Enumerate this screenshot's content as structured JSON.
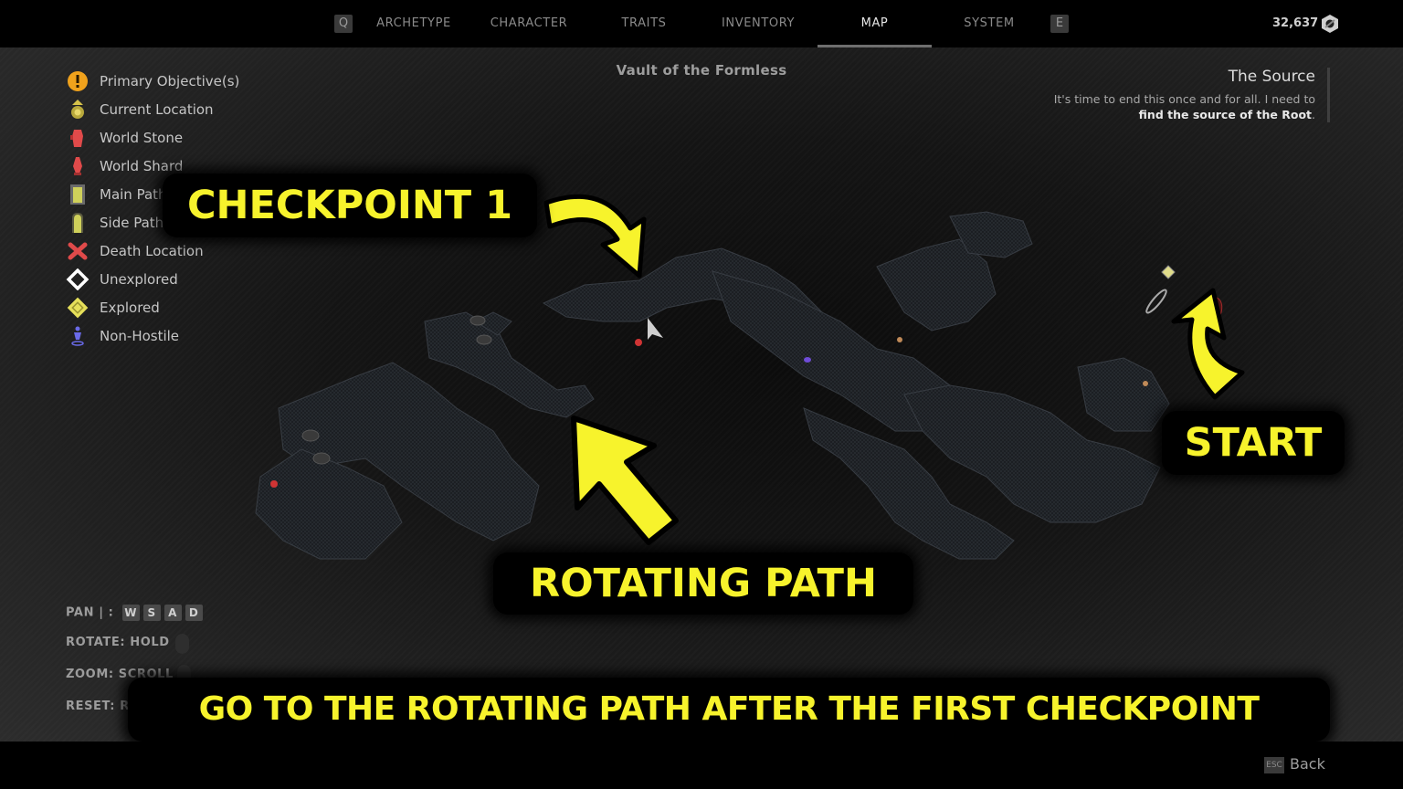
{
  "nav": {
    "prev_key": "Q",
    "next_key": "E",
    "tabs": [
      {
        "label": "ARCHETYPE",
        "active": false
      },
      {
        "label": "CHARACTER",
        "active": false
      },
      {
        "label": "TRAITS",
        "active": false
      },
      {
        "label": "INVENTORY",
        "active": false
      },
      {
        "label": "MAP",
        "active": true
      },
      {
        "label": "SYSTEM",
        "active": false
      }
    ],
    "currency": "32,637",
    "currency_icon": "scrap-hex-nut-icon"
  },
  "map": {
    "zone_title": "Vault of the Formless",
    "legend": [
      {
        "label": "Primary Objective(s)",
        "icon": "primary-objective-icon",
        "color": "#f0a21c"
      },
      {
        "label": "Current Location",
        "icon": "current-location-icon",
        "color": "#d6c24a"
      },
      {
        "label": "World Stone",
        "icon": "world-stone-icon",
        "color": "#e04a4a"
      },
      {
        "label": "World Shard",
        "icon": "world-shard-icon",
        "color": "#e04a4a"
      },
      {
        "label": "Main Path",
        "icon": "main-path-icon",
        "color": "#cfd05a"
      },
      {
        "label": "Side Path",
        "icon": "side-path-icon",
        "color": "#cfd05a"
      },
      {
        "label": "Death Location",
        "icon": "death-location-icon",
        "color": "#e04a4a"
      },
      {
        "label": "Unexplored",
        "icon": "unexplored-icon",
        "color": "#ffffff"
      },
      {
        "label": "Explored",
        "icon": "explored-icon",
        "color": "#e6e05a"
      },
      {
        "label": "Non-Hostile",
        "icon": "non-hostile-icon",
        "color": "#6a6ae8"
      }
    ],
    "quest": {
      "title": "The Source",
      "desc_plain": "It's time to end this once and for all. I need to",
      "desc_bold": "find the source of the Root",
      "desc_end": "."
    },
    "controls": {
      "pan_label": "PAN | :",
      "pan_keys": [
        "W",
        "S",
        "A",
        "D"
      ],
      "rotate_label": "ROTATE: HOLD",
      "zoom_label": "ZOOM: SCROLL",
      "reset_label": "RESET: R"
    }
  },
  "annotations": {
    "checkpoint": "CHECKPOINT 1",
    "start": "START",
    "rotating_path": "ROTATING PATH",
    "banner": "GO TO THE ROTATING PATH AFTER THE FIRST CHECKPOINT",
    "accent_color": "#f7f32c"
  },
  "footer": {
    "back_key": "ESC",
    "back_label": "Back"
  }
}
